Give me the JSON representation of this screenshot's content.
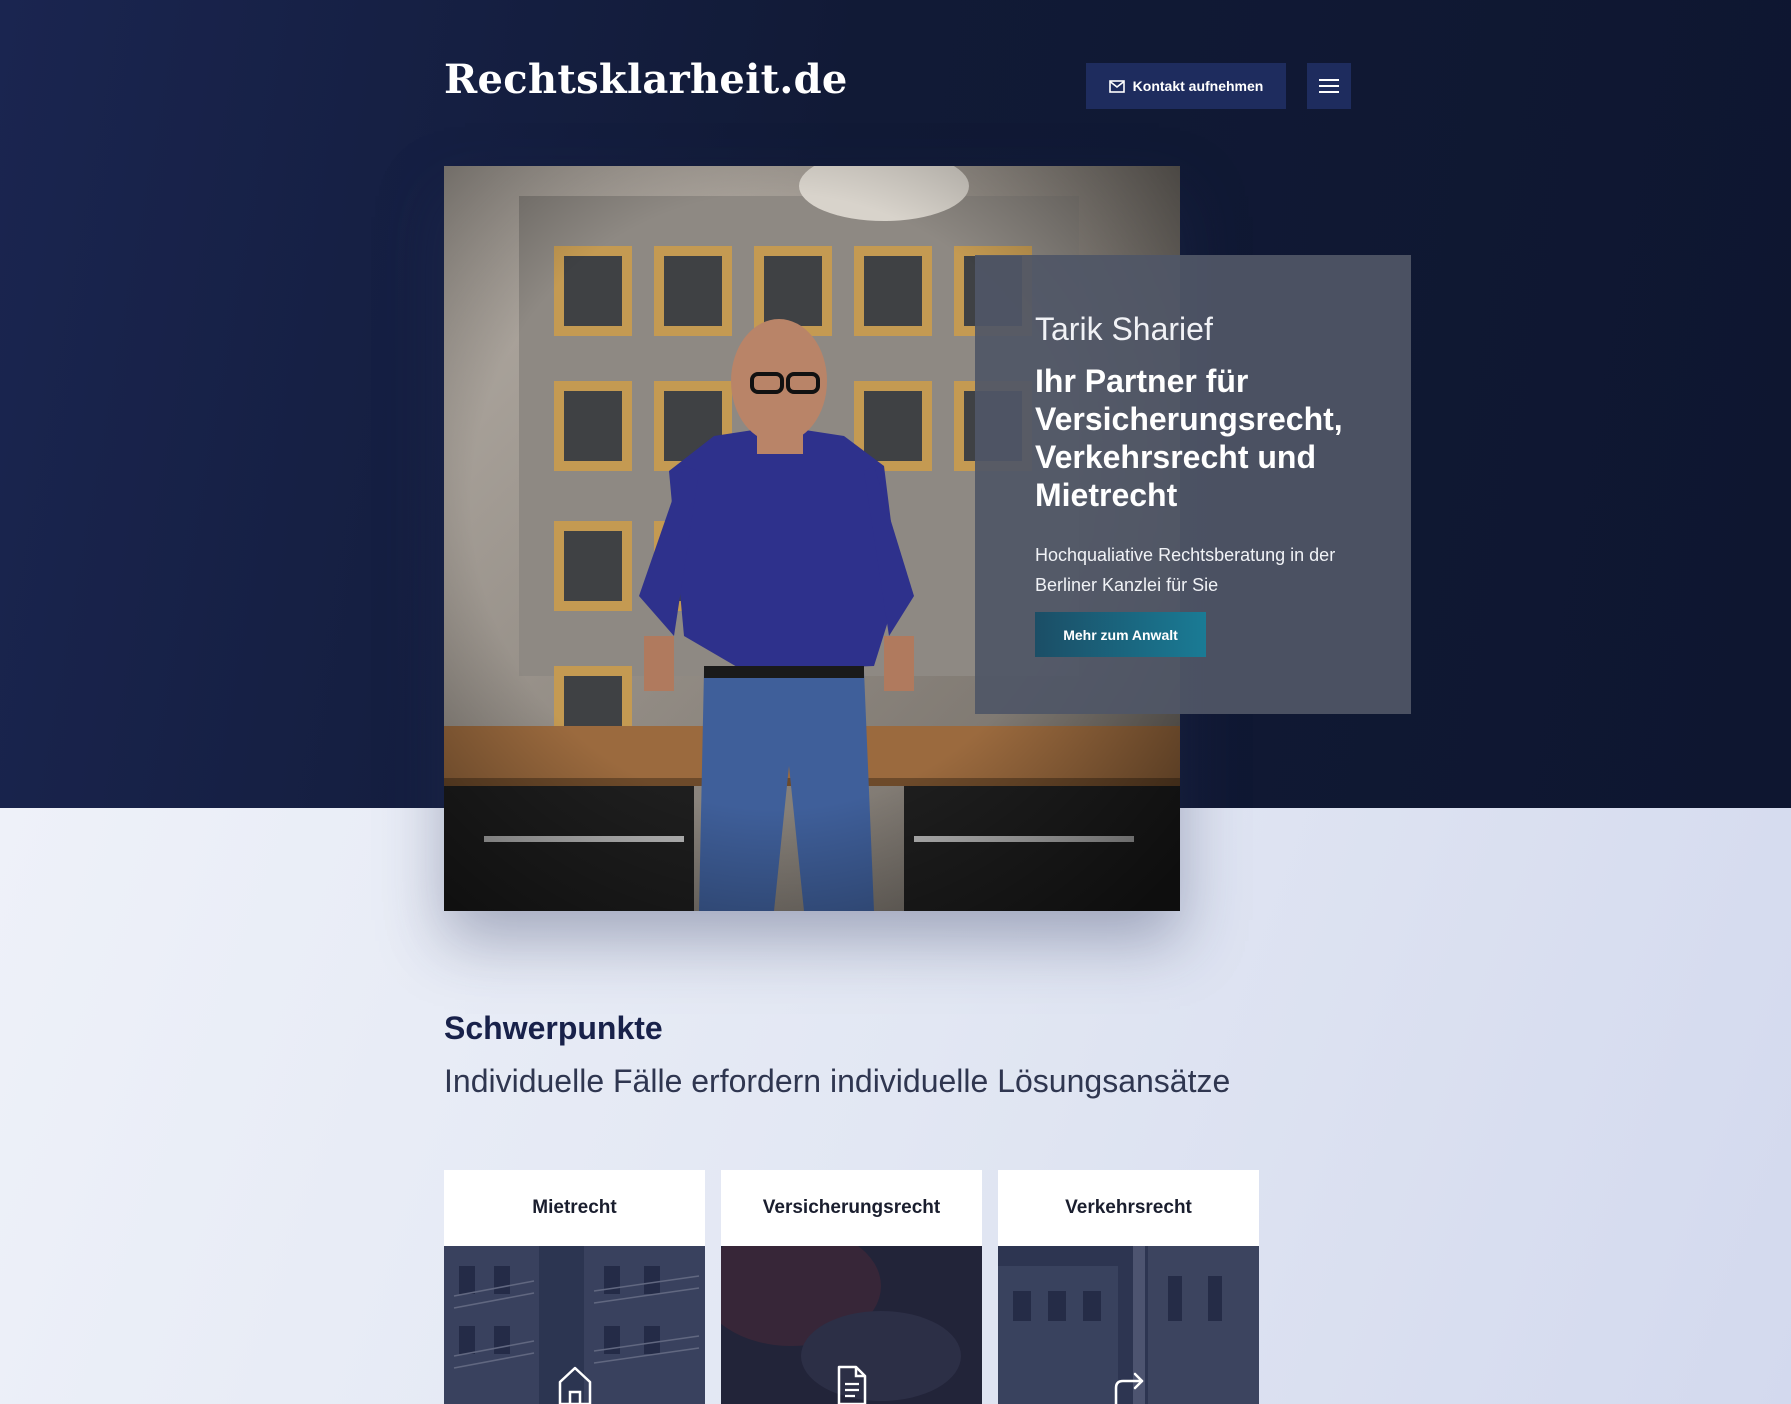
{
  "header": {
    "logo": "Rechtsklarheit.de",
    "contact_label": "Kontakt aufnehmen",
    "contact_icon": "mail-icon",
    "menu_icon": "hamburger-menu-icon"
  },
  "hero": {
    "name": "Tarik Sharief",
    "title": "Ihr Partner für Versicherungsrecht, Verkehrsrecht und Mietrecht",
    "subtitle": "Hochqualiative Rechtsberatung in der Berliner Kanzlei für Sie",
    "button_label": "Mehr zum Anwalt"
  },
  "focus": {
    "title": "Schwerpunkte",
    "subtitle": "Individuelle Fälle erfordern individuelle Lösungsansätze",
    "cards": [
      {
        "label": "Mietrecht",
        "icon": "house-icon"
      },
      {
        "label": "Versicherungsrecht",
        "icon": "document-icon"
      },
      {
        "label": "Verkehrsrecht",
        "icon": "turn-right-arrow-icon"
      }
    ]
  },
  "colors": {
    "hero_bg": "#111a36",
    "button_dark": "#1e2c5e",
    "accent_teal": "#1a7b95",
    "heading": "#18214a"
  }
}
